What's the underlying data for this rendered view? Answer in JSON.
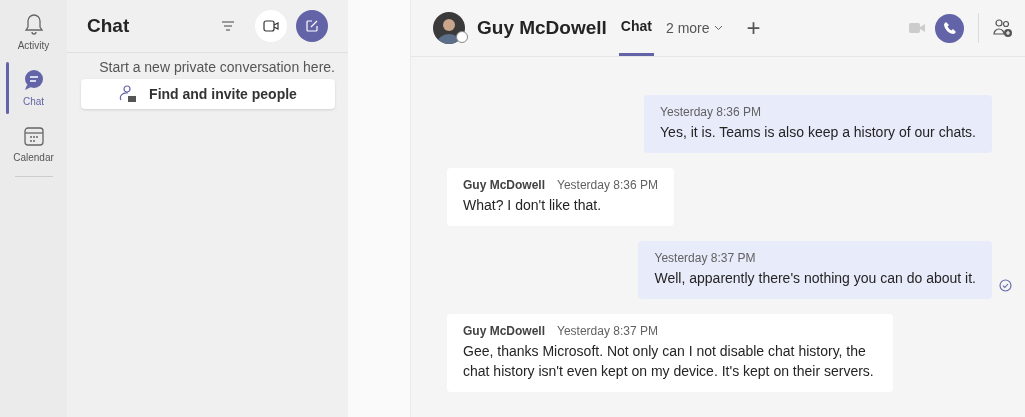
{
  "rail": [
    {
      "label": "Activity",
      "kind": "bell",
      "selected": false
    },
    {
      "label": "Chat",
      "kind": "chat",
      "selected": true
    },
    {
      "label": "Calendar",
      "kind": "calendar",
      "selected": false
    }
  ],
  "chat_list": {
    "title": "Chat",
    "hint": "Start a new private conversation here.",
    "invite_button": "Find and invite people"
  },
  "conversation": {
    "name": "Guy McDowell",
    "tabs": [
      {
        "label": "Chat",
        "selected": true
      }
    ],
    "more_tabs": "2 more",
    "add_tab": "+"
  },
  "messages": [
    {
      "kind": "mine",
      "time": "Yesterday 8:36 PM",
      "text": "Yes, it is. Teams is also keep a history of our chats.",
      "seen": false
    },
    {
      "kind": "theirs",
      "author": "Guy McDowell",
      "time": "Yesterday 8:36 PM",
      "text": "What? I don't like that."
    },
    {
      "kind": "mine",
      "time": "Yesterday 8:37 PM",
      "text": "Well, apparently there's nothing you can do about it.",
      "seen": true
    },
    {
      "kind": "theirs",
      "author": "Guy McDowell",
      "time": "Yesterday 8:37 PM",
      "text": "Gee, thanks Microsoft. Not only can I not disable chat history, the chat history isn't even kept on my device. It's kept on their servers."
    }
  ]
}
